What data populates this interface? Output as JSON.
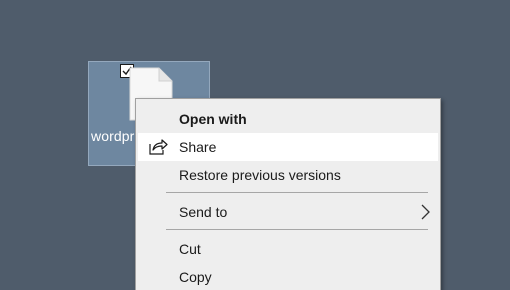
{
  "desktop": {
    "file_icon": {
      "label": "wordpr",
      "selected": true,
      "checked": true,
      "icon": "blank-file-icon"
    }
  },
  "context_menu": {
    "items": [
      {
        "label": "Open with",
        "bold": true
      },
      {
        "label": "Share",
        "icon": "share-icon",
        "hovered": true
      },
      {
        "label": "Restore previous versions"
      },
      {
        "label": "Send to",
        "submenu": true,
        "submenu_icon": "chevron-right-icon"
      },
      {
        "label": "Cut"
      },
      {
        "label": "Copy"
      }
    ]
  },
  "colors": {
    "desktop_background": "#4f5c6b",
    "selection_fill": "#6e87a0",
    "menu_background": "#eeeeee",
    "menu_hover": "#ffffff"
  }
}
